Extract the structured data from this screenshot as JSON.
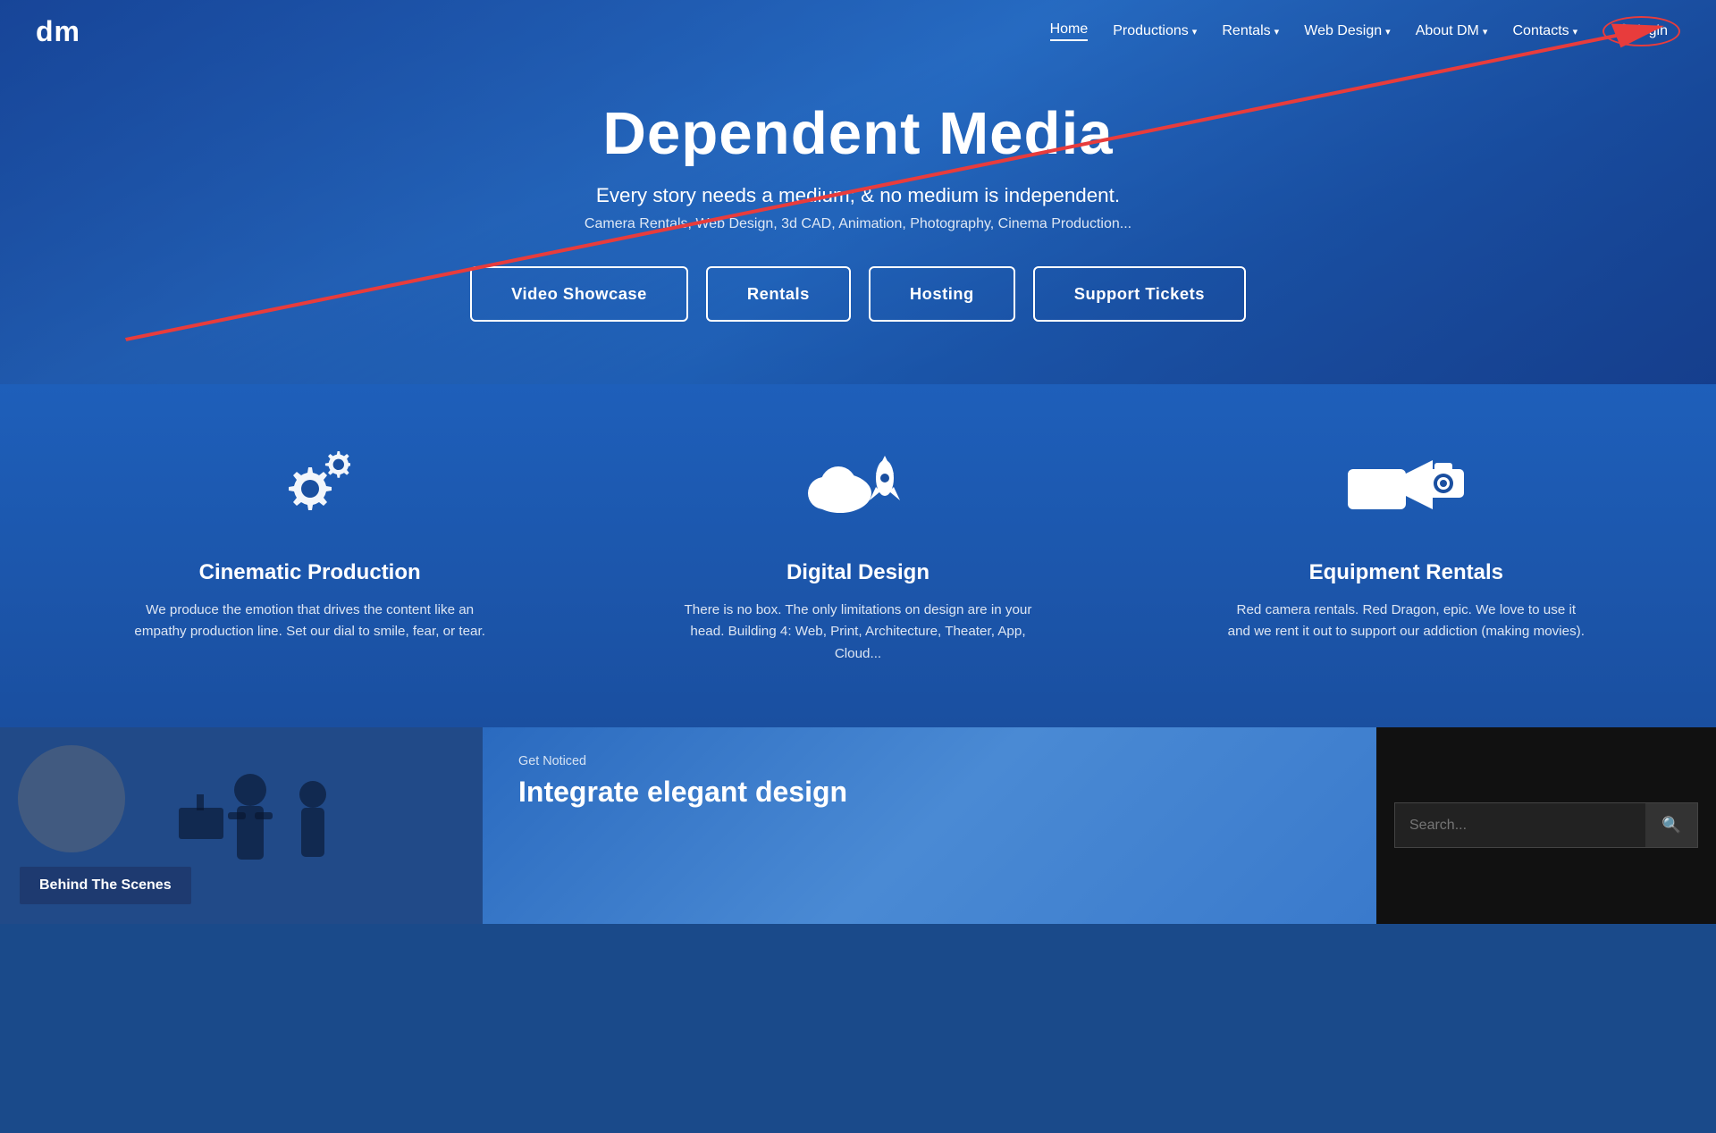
{
  "navbar": {
    "logo": "dm",
    "links": [
      {
        "label": "Home",
        "active": true,
        "has_chevron": false
      },
      {
        "label": "Productions",
        "active": false,
        "has_chevron": true
      },
      {
        "label": "Rentals",
        "active": false,
        "has_chevron": true
      },
      {
        "label": "Web Design",
        "active": false,
        "has_chevron": true
      },
      {
        "label": "About DM",
        "active": false,
        "has_chevron": true
      },
      {
        "label": "Contacts",
        "active": false,
        "has_chevron": true
      }
    ],
    "login_label": "login",
    "lock_icon": "🔒"
  },
  "hero": {
    "title": "Dependent Media",
    "subtitle": "Every story needs a medium; & no medium is independent.",
    "services": "Camera Rentals, Web Design, 3d CAD, Animation, Photography, Cinema Production...",
    "buttons": [
      {
        "label": "Video Showcase"
      },
      {
        "label": "Rentals"
      },
      {
        "label": "Hosting"
      },
      {
        "label": "Support Tickets"
      }
    ]
  },
  "features": [
    {
      "id": "cinematic",
      "icon": "⚙",
      "title": "Cinematic Production",
      "description": "We produce the emotion that drives the content like an empathy production line. Set our dial to smile, fear, or tear."
    },
    {
      "id": "digital",
      "icon": "☁",
      "title": "Digital Design",
      "description": "There is no box. The only limitations on design are in your head. Building 4: Web, Print, Architecture, Theater, App, Cloud..."
    },
    {
      "id": "equipment",
      "icon": "📷",
      "title": "Equipment Rentals",
      "description": "Red camera rentals. Red Dragon, epic. We love to use it and we rent it out to support our addiction (making movies)."
    }
  ],
  "bottom": {
    "behind_scenes_label": "Behind The Scenes",
    "get_noticed_label": "Get Noticed",
    "integrate_title": "Integrate elegant design",
    "search_placeholder": "Search...",
    "search_btn_icon": "🔍"
  },
  "arrow": {
    "visible": true
  },
  "colors": {
    "hero_bg": "#1e5ab5",
    "features_bg": "#1a4fa0",
    "nav_bg": "transparent",
    "accent_red": "#e83c3c",
    "dark_bg": "#111"
  }
}
